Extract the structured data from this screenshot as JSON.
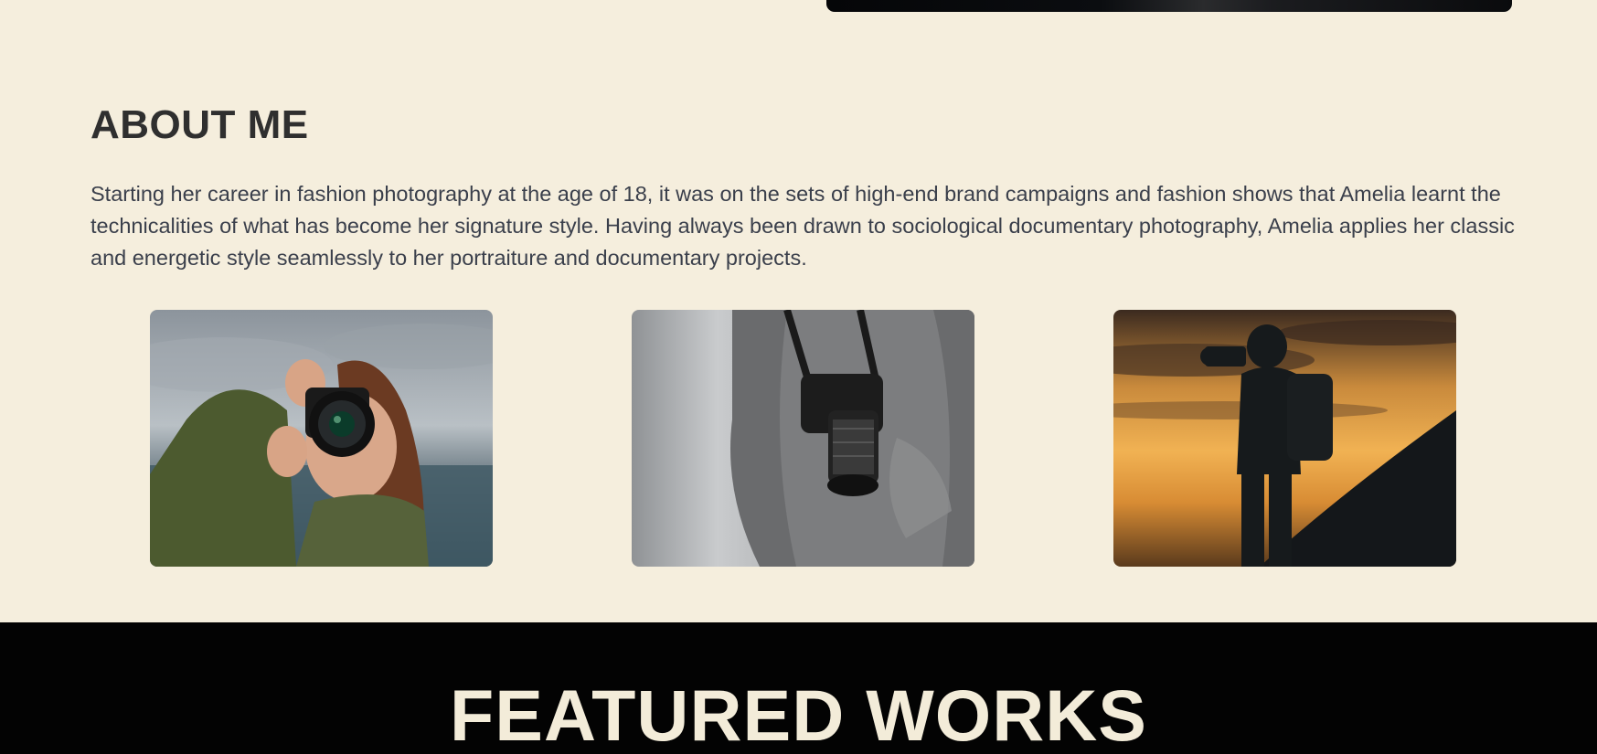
{
  "about": {
    "heading": "ABOUT ME",
    "paragraph": "Starting her career in fashion photography at the age of 18, it was on the sets of high-end brand campaigns and fashion shows that Amelia learnt the technicalities of what has become her signature style. Having always been drawn to sociological documentary photography, Amelia applies her classic and energetic style seamlessly to her portraiture and documentary projects."
  },
  "gallery": {
    "photos": [
      {
        "subject": "woman-with-camera-photo"
      },
      {
        "subject": "camera-on-hoodie-photo"
      },
      {
        "subject": "sunset-silhouette-photographer-photo"
      }
    ]
  },
  "featured": {
    "heading": "FEATURED WORKS"
  },
  "colors": {
    "background": "#f5eedd",
    "heading_text": "#2f2f2f",
    "body_text": "#3a3f4b",
    "featured_background": "#030303",
    "featured_text": "#f3ecd9"
  }
}
